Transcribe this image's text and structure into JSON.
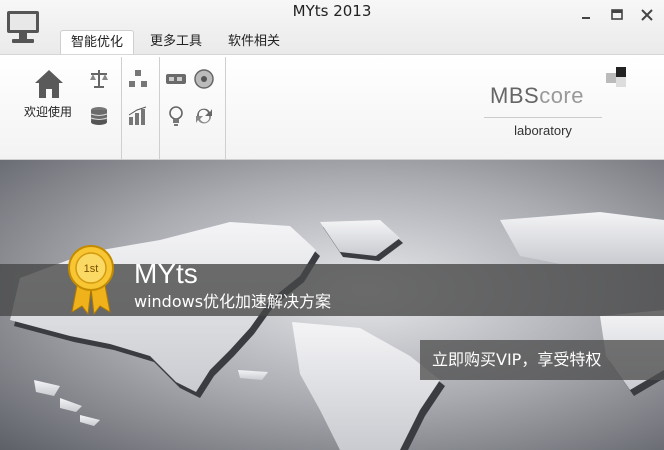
{
  "window": {
    "title": "MYts 2013"
  },
  "tabs": [
    {
      "label": "智能优化",
      "active": true
    },
    {
      "label": "更多工具",
      "active": false
    },
    {
      "label": "软件相关",
      "active": false
    }
  ],
  "ribbon": {
    "welcome_label": "欢迎使用",
    "tool_icons": [
      "scale-icon",
      "database-icon",
      "network-icon",
      "bar-chart-icon",
      "memory-icon",
      "disc-icon",
      "lightbulb-icon",
      "refresh-icon"
    ]
  },
  "brand": {
    "text_mb": "MBS",
    "text_core": "core",
    "subtitle": "laboratory"
  },
  "banner": {
    "product_name": "MYts",
    "description": "windows优化加速解决方案",
    "medal_text": "1st",
    "vip_label": "立即购买VIP，享受特权"
  },
  "colors": {
    "band": "#464646",
    "medal_gold": "#f2b81e",
    "ribbon_bg": "#f6f6f6"
  }
}
